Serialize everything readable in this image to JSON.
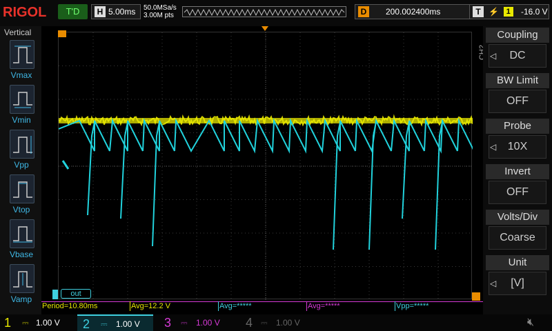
{
  "brand": "RIGOL",
  "trigger_status": "T'D",
  "horizontal": {
    "key": "H",
    "value": "5.00ms"
  },
  "sample_rate": "50.0MSa/s",
  "memory_depth": "3.00M pts",
  "delay": {
    "key": "D",
    "value": "200.002400ms"
  },
  "trigger": {
    "key": "T",
    "source": "1",
    "level": "-16.0 V",
    "icon": "rising-edge-icon"
  },
  "left_panel": {
    "title": "Vertical",
    "items": [
      "Vmax",
      "Vmin",
      "Vpp",
      "Vtop",
      "Vbase",
      "Vamp"
    ]
  },
  "right_panel": {
    "channel": "CH2",
    "blocks": [
      {
        "title": "Coupling",
        "value": "DC",
        "arrow": true
      },
      {
        "title": "BW Limit",
        "value": "OFF",
        "arrow": false
      },
      {
        "title": "Probe",
        "value": "10X",
        "arrow": true
      },
      {
        "title": "Invert",
        "value": "OFF",
        "arrow": false
      },
      {
        "title": "Volts/Div",
        "value": "Coarse",
        "arrow": false
      },
      {
        "title": "Unit",
        "value": "[V]",
        "arrow": true
      }
    ]
  },
  "label_box": "out",
  "measurements": [
    {
      "text": "Period=10.80ms",
      "color": "#e8e800"
    },
    {
      "text": "Avg=12.2 V",
      "color": "#e8e800"
    },
    {
      "text": "Avg=*****",
      "color": "#3fd0e0"
    },
    {
      "text": "Avg=*****",
      "color": "#d63ad6"
    },
    {
      "text": "Vpp=*****",
      "color": "#3fd0e0"
    }
  ],
  "channels": [
    {
      "num": "1",
      "scale": "1.00 V",
      "color": "#e8e800",
      "active": false
    },
    {
      "num": "2",
      "scale": "1.00 V",
      "color": "#3fd0e0",
      "active": true
    },
    {
      "num": "3",
      "scale": "1.00 V",
      "color": "#d63ad6",
      "active": false
    },
    {
      "num": "4",
      "scale": "1.00 V",
      "color": "#666666",
      "active": false
    }
  ],
  "colors": {
    "ch1": "#e8e800",
    "ch2": "#21d2dc",
    "ch3": "#d63ad6",
    "accent": "#e98c00",
    "grid": "#3a3a3a"
  }
}
